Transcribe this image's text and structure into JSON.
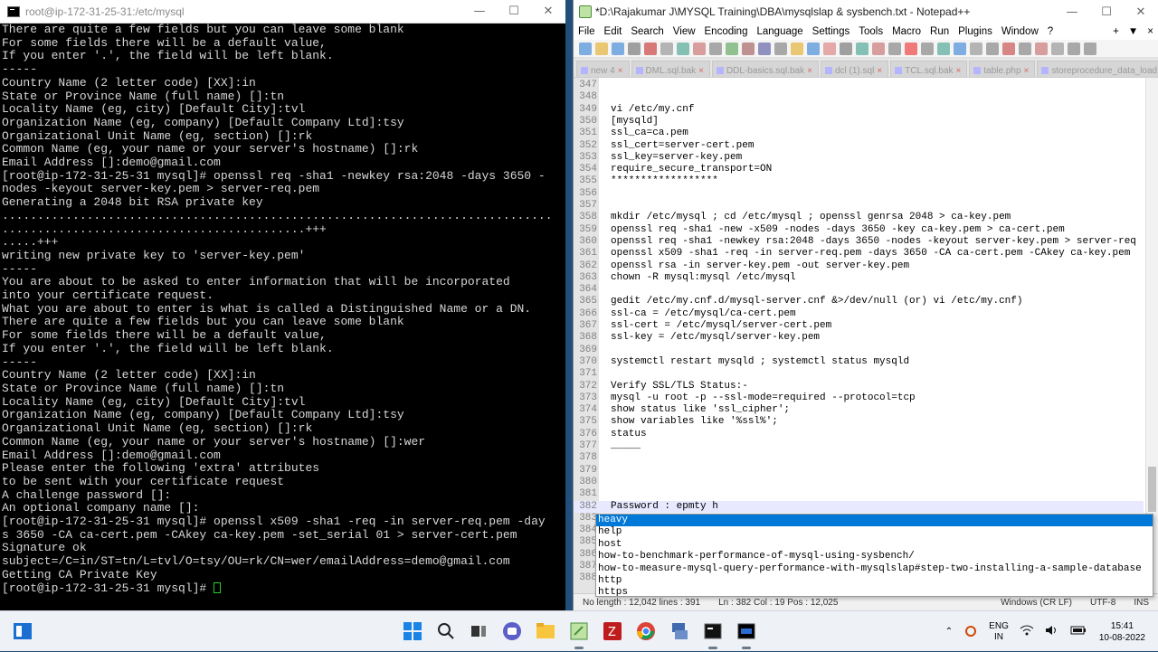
{
  "terminal": {
    "title": "root@ip-172-31-25-31:/etc/mysql",
    "lines": [
      "There are quite a few fields but you can leave some blank",
      "For some fields there will be a default value,",
      "If you enter '.', the field will be left blank.",
      "-----",
      "Country Name (2 letter code) [XX]:in",
      "State or Province Name (full name) []:tn",
      "Locality Name (eg, city) [Default City]:tvl",
      "Organization Name (eg, company) [Default Company Ltd]:tsy",
      "Organizational Unit Name (eg, section) []:rk",
      "Common Name (eg, your name or your server's hostname) []:rk",
      "Email Address []:demo@gmail.com",
      "[root@ip-172-31-25-31 mysql]# openssl req -sha1 -newkey rsa:2048 -days 3650 -",
      "nodes -keyout server-key.pem > server-req.pem",
      "Generating a 2048 bit RSA private key",
      "..............................................................................",
      "...........................................+++",
      ".....+++",
      "writing new private key to 'server-key.pem'",
      "-----",
      "You are about to be asked to enter information that will be incorporated",
      "into your certificate request.",
      "What you are about to enter is what is called a Distinguished Name or a DN.",
      "There are quite a few fields but you can leave some blank",
      "For some fields there will be a default value,",
      "If you enter '.', the field will be left blank.",
      "-----",
      "Country Name (2 letter code) [XX]:in",
      "State or Province Name (full name) []:tn",
      "Locality Name (eg, city) [Default City]:tvl",
      "Organization Name (eg, company) [Default Company Ltd]:tsy",
      "Organizational Unit Name (eg, section) []:rk",
      "Common Name (eg, your name or your server's hostname) []:wer",
      "Email Address []:demo@gmail.com",
      "",
      "Please enter the following 'extra' attributes",
      "to be sent with your certificate request",
      "A challenge password []:",
      "An optional company name []:",
      "[root@ip-172-31-25-31 mysql]# openssl x509 -sha1 -req -in server-req.pem -day",
      "s 3650 -CA ca-cert.pem -CAkey ca-key.pem -set_serial 01 > server-cert.pem",
      "Signature ok",
      "subject=/C=in/ST=tn/L=tvl/O=tsy/OU=rk/CN=wer/emailAddress=demo@gmail.com",
      "Getting CA Private Key"
    ],
    "prompt": "[root@ip-172-31-25-31 mysql]# "
  },
  "npp": {
    "title": "*D:\\Rajakumar J\\MYSQL Training\\DBA\\mysqlslap & sysbench.txt - Notepad++",
    "menu": [
      "File",
      "Edit",
      "Search",
      "View",
      "Encoding",
      "Language",
      "Settings",
      "Tools",
      "Macro",
      "Run",
      "Plugins",
      "Window",
      "?"
    ],
    "menu_right": [
      "+",
      "▼",
      "×"
    ],
    "tabs": [
      "new 4",
      "DML.sql.bak",
      "DDL-basics.sql.bak",
      "dcl (1).sql",
      "TCL.sql.bak",
      "table.php",
      "storeprocedure_data_load.sql"
    ],
    "lines": [
      {
        "n": "347",
        "t": ""
      },
      {
        "n": "348",
        "t": ""
      },
      {
        "n": "349",
        "t": "vi /etc/my.cnf"
      },
      {
        "n": "350",
        "t": "[mysqld]"
      },
      {
        "n": "351",
        "t": "ssl_ca=ca.pem"
      },
      {
        "n": "352",
        "t": "ssl_cert=server-cert.pem"
      },
      {
        "n": "353",
        "t": "ssl_key=server-key.pem"
      },
      {
        "n": "354",
        "t": "require_secure_transport=ON"
      },
      {
        "n": "355",
        "t": "******************"
      },
      {
        "n": "356",
        "t": ""
      },
      {
        "n": "357",
        "t": ""
      },
      {
        "n": "358",
        "t": "mkdir /etc/mysql ; cd /etc/mysql ; openssl genrsa 2048 > ca-key.pem"
      },
      {
        "n": "359",
        "t": "openssl req -sha1 -new -x509 -nodes -days 3650 -key ca-key.pem > ca-cert.pem"
      },
      {
        "n": "360",
        "t": "openssl req -sha1 -newkey rsa:2048 -days 3650 -nodes -keyout server-key.pem > server-req"
      },
      {
        "n": "361",
        "t": "openssl x509 -sha1 -req -in server-req.pem -days 3650 -CA ca-cert.pem -CAkey ca-key.pem"
      },
      {
        "n": "362",
        "t": "openssl rsa -in server-key.pem -out server-key.pem"
      },
      {
        "n": "363",
        "t": "chown -R mysql:mysql /etc/mysql"
      },
      {
        "n": "364",
        "t": ""
      },
      {
        "n": "365",
        "t": "gedit /etc/my.cnf.d/mysql-server.cnf &>/dev/null (or) vi /etc/my.cnf)"
      },
      {
        "n": "366",
        "t": "ssl-ca = /etc/mysql/ca-cert.pem"
      },
      {
        "n": "367",
        "t": "ssl-cert = /etc/mysql/server-cert.pem"
      },
      {
        "n": "368",
        "t": "ssl-key = /etc/mysql/server-key.pem"
      },
      {
        "n": "369",
        "t": ""
      },
      {
        "n": "370",
        "t": "systemctl restart mysqld ; systemctl status mysqld"
      },
      {
        "n": "371",
        "t": ""
      },
      {
        "n": "372",
        "t": "Verify SSL/TLS Status:-"
      },
      {
        "n": "373",
        "t": "mysql -u root -p --ssl-mode=required --protocol=tcp"
      },
      {
        "n": "374",
        "t": "show status like 'ssl_cipher';"
      },
      {
        "n": "375",
        "t": "show variables like '%ssl%';"
      },
      {
        "n": "376",
        "t": "status"
      },
      {
        "n": "377",
        "t": "_____"
      },
      {
        "n": "378",
        "t": ""
      },
      {
        "n": "379",
        "t": ""
      },
      {
        "n": "380",
        "t": ""
      },
      {
        "n": "381",
        "t": ""
      },
      {
        "n": "382",
        "t": "Password : epmty h"
      },
      {
        "n": "383",
        "t": ""
      },
      {
        "n": "384",
        "t": ""
      },
      {
        "n": "385",
        "t": ""
      },
      {
        "n": "386",
        "t": ""
      },
      {
        "n": "387",
        "t": ""
      },
      {
        "n": "388",
        "t": ""
      }
    ],
    "autocomplete": [
      "heavy",
      "help",
      "host",
      "how-to-benchmark-performance-of-mysql-using-sysbench/",
      "how-to-measure-mysql-query-performance-with-mysqlslap#step-two-installing-a-sample-database",
      "http",
      "https"
    ],
    "status": {
      "length": "No length : 12,042    lines : 391",
      "ln": "Ln : 382   Col : 19   Pos : 12,025",
      "eol": "Windows (CR LF)",
      "enc": "UTF-8",
      "ins": "INS"
    }
  },
  "taskbar": {
    "lang1": "ENG",
    "lang2": "IN",
    "time": "15:41",
    "date": "10-08-2022"
  },
  "colors": {
    "accent": "#0078d7",
    "terminal_bg": "#000000",
    "terminal_fg": "#d7d7d7",
    "cursor": "#23d123"
  }
}
